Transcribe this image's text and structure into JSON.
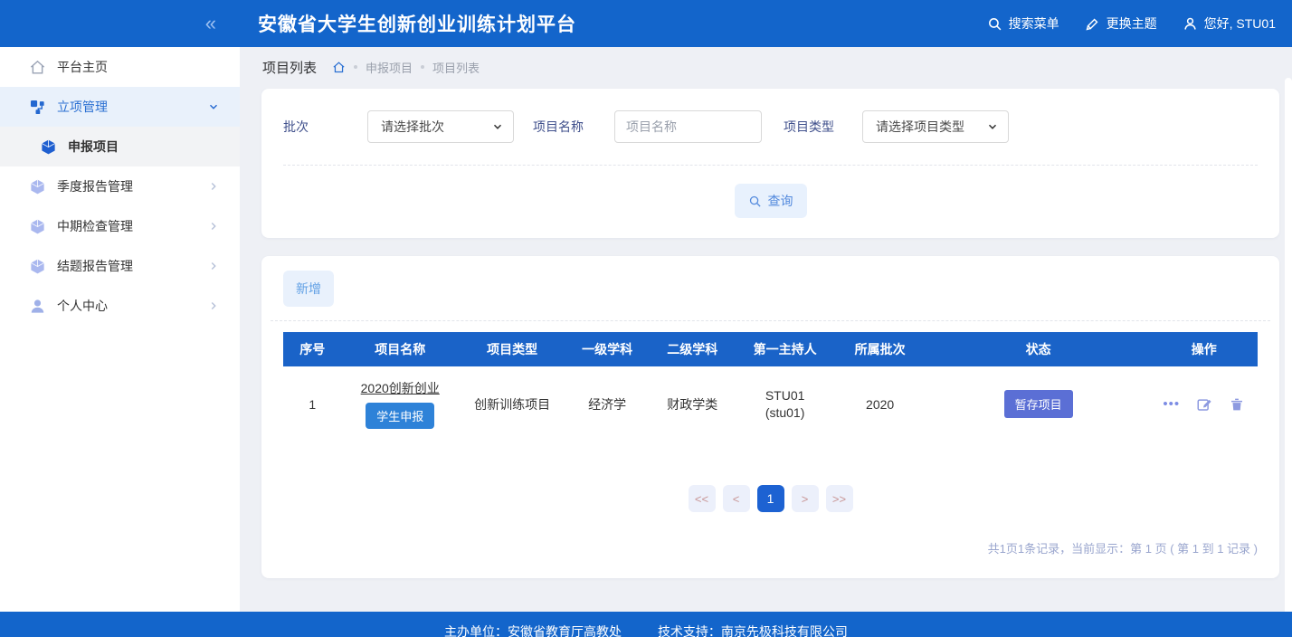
{
  "header": {
    "title": "安徽省大学生创新创业训练计划平台",
    "collapse_icon": "«",
    "search_menu": "搜索菜单",
    "change_theme": "更换主题",
    "greeting": "您好, STU01"
  },
  "sidebar": {
    "items": [
      {
        "label": "平台主页",
        "icon": "home-icon"
      },
      {
        "label": "立项管理",
        "icon": "project-nodes-icon",
        "state": "expanded-active"
      },
      {
        "label": "申报项目",
        "icon": "cube-icon",
        "state": "selected-subitem"
      },
      {
        "label": "季度报告管理",
        "icon": "cube-icon"
      },
      {
        "label": "中期检查管理",
        "icon": "cube-icon"
      },
      {
        "label": "结题报告管理",
        "icon": "cube-icon"
      },
      {
        "label": "个人中心",
        "icon": "user-icon"
      }
    ]
  },
  "breadcrumb": {
    "page_title": "项目列表",
    "crumbs": [
      "申报项目",
      "项目列表"
    ]
  },
  "filters": {
    "batch_label": "批次",
    "batch_placeholder": "请选择批次",
    "name_label": "项目名称",
    "name_placeholder": "项目名称",
    "type_label": "项目类型",
    "type_placeholder": "请选择项目类型",
    "query_label": "查询"
  },
  "toolbar": {
    "add_label": "新增"
  },
  "table": {
    "headers": [
      "序号",
      "项目名称",
      "项目类型",
      "一级学科",
      "二级学科",
      "第一主持人",
      "所属批次",
      "状态",
      "操作"
    ],
    "rows": [
      {
        "index": "1",
        "name": "2020创新创业",
        "name_badge": "学生申报",
        "type": "创新训练项目",
        "discipline1": "经济学",
        "discipline2": "财政学类",
        "leader": "STU01",
        "leader_account": "(stu01)",
        "batch": "2020",
        "status": "暂存项目",
        "ops_more": "•••"
      }
    ]
  },
  "pagination": {
    "first": "<<",
    "prev": "<",
    "current": "1",
    "next": ">",
    "last": ">>",
    "summary": "共1页1条记录，当前显示：第 1 页 ( 第 1 到 1 记录 )"
  },
  "footer": {
    "organizer": "主办单位：安徽省教育厅高教处",
    "support": "技术支持：南京先极科技有限公司"
  },
  "colors": {
    "header_blue": "#1365cb",
    "table_header_blue": "#1a63c8",
    "badge_student": "#2e82d8",
    "badge_status": "#5b6fd5"
  }
}
